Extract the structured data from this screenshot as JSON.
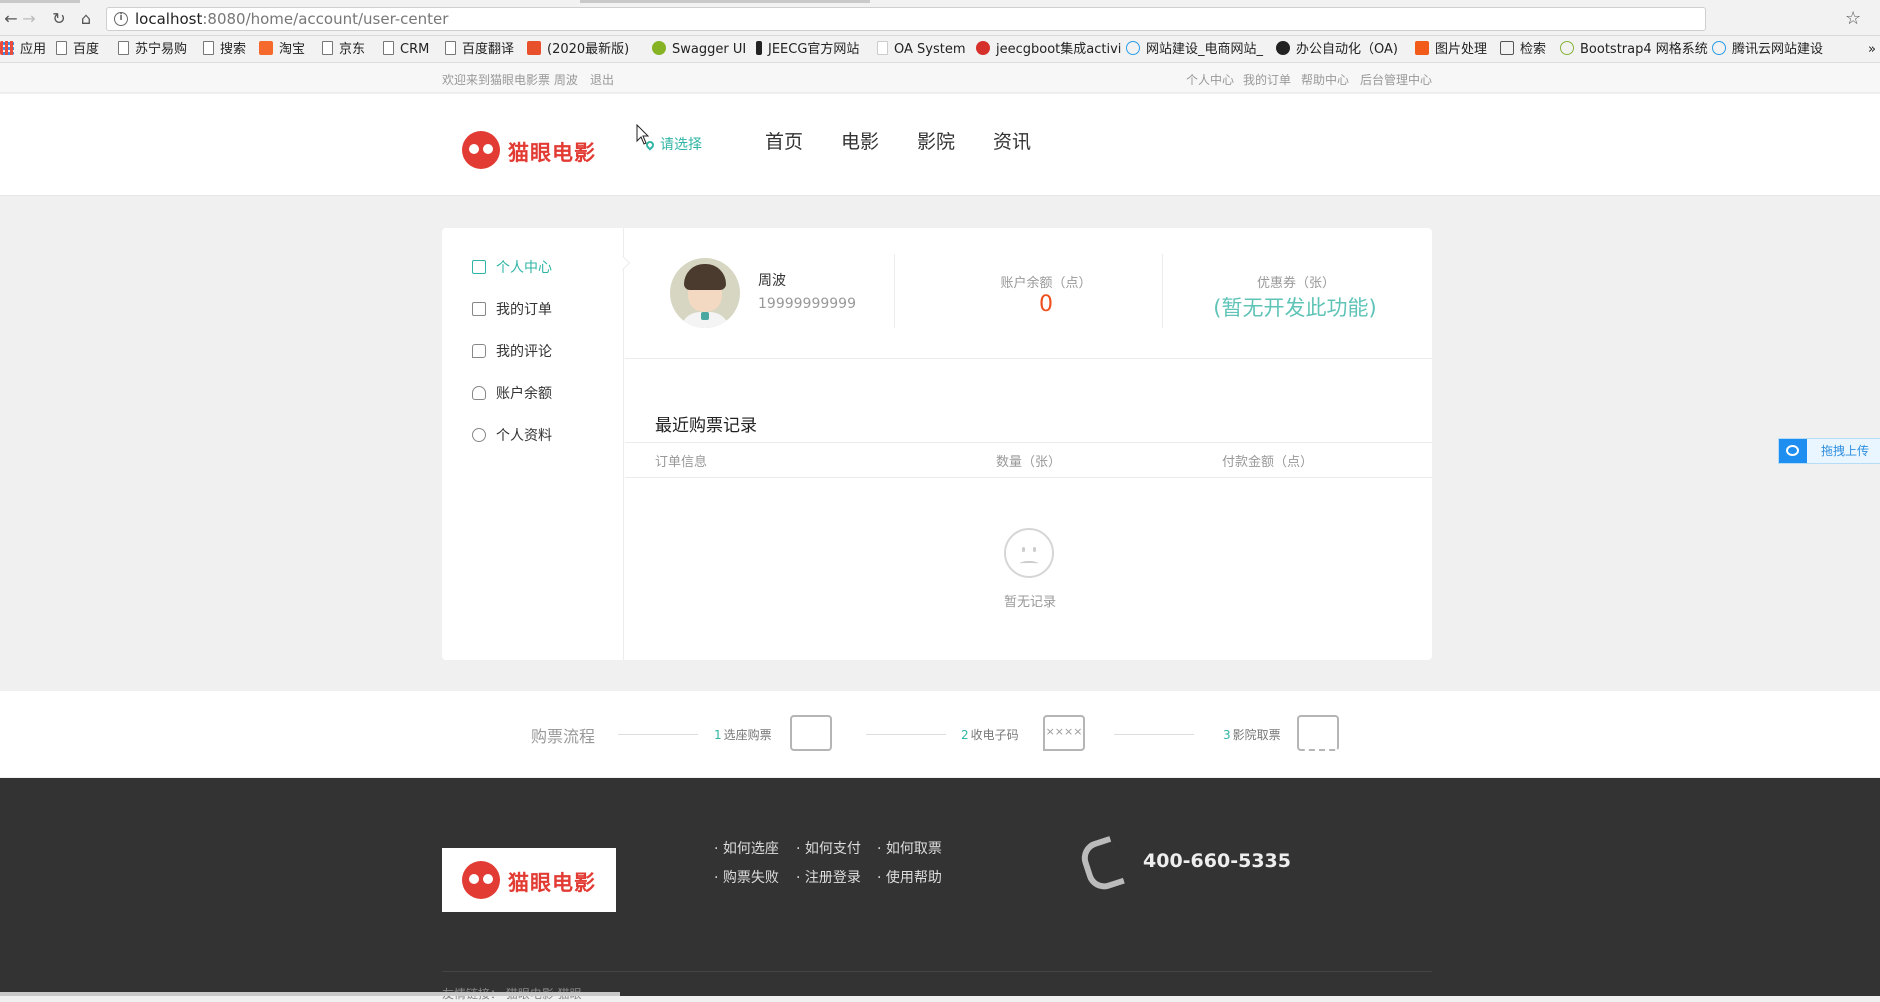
{
  "browser": {
    "url_host": "localhost",
    "url_path": ":8080/home/account/user-center",
    "bookmarks": [
      "应用",
      "百度",
      "苏宁易购",
      "搜索",
      "淘宝",
      "京东",
      "CRM",
      "百度翻译",
      "(2020最新版)",
      "Swagger UI",
      "JEECG官方网站",
      "OA System",
      "jeecgboot集成activi",
      "网站建设_电商网站_",
      "办公自动化（OA)",
      "图片处理",
      "检索",
      "Bootstrap4 网格系统",
      "腾讯云网站建设"
    ]
  },
  "topbar": {
    "welcome": "欢迎来到猫眼电影票 周波",
    "logout": "退出",
    "links": [
      "个人中心",
      "我的订单",
      "帮助中心",
      "后台管理中心"
    ]
  },
  "header": {
    "logo_text": "猫眼电影",
    "city": "请选择",
    "nav": [
      "首页",
      "电影",
      "影院",
      "资讯"
    ]
  },
  "sidebar": {
    "items": [
      "个人中心",
      "我的订单",
      "我的评论",
      "账户余额",
      "个人资料"
    ],
    "active_index": 0
  },
  "profile": {
    "name": "周波",
    "phone": "19999999999",
    "balance_label": "账户余额（点）",
    "balance_value": "0",
    "coupon_label": "优惠券（张）",
    "coupon_value": "(暂无开发此功能)"
  },
  "records": {
    "title": "最近购票记录",
    "columns": [
      "订单信息",
      "数量（张）",
      "付款金额（点）"
    ],
    "empty_text": "暂无记录"
  },
  "flow": {
    "title": "购票流程",
    "steps": [
      {
        "n": "1",
        "label": "选座购票"
      },
      {
        "n": "2",
        "label": "收电子码"
      },
      {
        "n": "3",
        "label": "影院取票"
      }
    ],
    "code_placeholder": "××××"
  },
  "footer": {
    "logo_text": "猫眼电影",
    "links": [
      "如何选座",
      "如何支付",
      "如何取票",
      "购票失败",
      "注册登录",
      "使用帮助"
    ],
    "hotline": "400-660-5335",
    "bottom": "友情链接：  猫眼电影    猫眼"
  },
  "upload_widget": {
    "label": "拖拽上传"
  },
  "colors": {
    "brand_red": "#e23b34",
    "accent_teal": "#30b5a5",
    "balance_orange": "#ef4f1b",
    "footer_bg": "#333333"
  }
}
